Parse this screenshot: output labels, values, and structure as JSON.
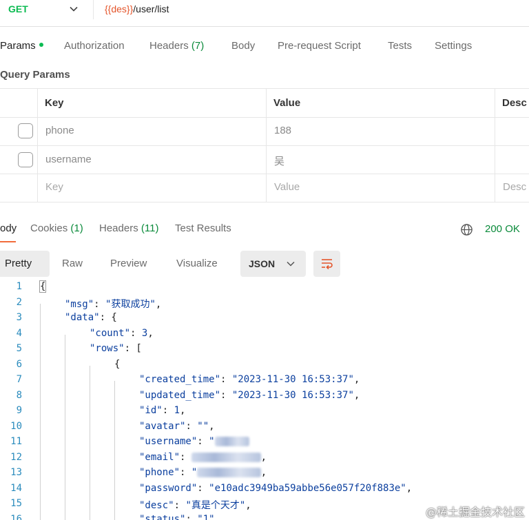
{
  "request": {
    "method": "GET",
    "url_var": "{{des}}",
    "url_path": "/user/list"
  },
  "req_tabs": [
    {
      "label": "Params",
      "count": "",
      "dot": true
    },
    {
      "label": "Authorization",
      "count": "",
      "dot": false
    },
    {
      "label": "Headers",
      "count": "(7)",
      "dot": false
    },
    {
      "label": "Body",
      "count": "",
      "dot": false
    },
    {
      "label": "Pre-request Script",
      "count": "",
      "dot": false
    },
    {
      "label": "Tests",
      "count": "",
      "dot": false
    },
    {
      "label": "Settings",
      "count": "",
      "dot": false
    }
  ],
  "query_params": {
    "title": "Query Params",
    "headers": {
      "key": "Key",
      "value": "Value",
      "desc": "Desc"
    },
    "rows": [
      {
        "key": "phone",
        "value": "188"
      },
      {
        "key": "username",
        "value": "吴"
      }
    ],
    "placeholders": {
      "key": "Key",
      "value": "Value",
      "desc": "Desc"
    }
  },
  "resp_tabs": [
    {
      "label": "ody",
      "count": ""
    },
    {
      "label": "Cookies",
      "count": "(1)"
    },
    {
      "label": "Headers",
      "count": "(11)"
    },
    {
      "label": "Test Results",
      "count": ""
    }
  ],
  "status": "200 OK",
  "views": [
    "Pretty",
    "Raw",
    "Preview",
    "Visualize"
  ],
  "format": "JSON",
  "code_lines": [
    {
      "n": "1",
      "parts": [
        [
          "pun",
          "{"
        ]
      ]
    },
    {
      "n": "2",
      "parts": [
        [
          "key",
          "\"msg\""
        ],
        [
          "pun",
          ": "
        ],
        [
          "str",
          "\"获取成功\""
        ],
        [
          "pun",
          ","
        ]
      ]
    },
    {
      "n": "3",
      "parts": [
        [
          "key",
          "\"data\""
        ],
        [
          "pun",
          ": {"
        ]
      ]
    },
    {
      "n": "4",
      "parts": [
        [
          "key",
          "\"count\""
        ],
        [
          "pun",
          ": "
        ],
        [
          "str",
          "3"
        ],
        [
          "pun",
          ","
        ]
      ]
    },
    {
      "n": "5",
      "parts": [
        [
          "key",
          "\"rows\""
        ],
        [
          "pun",
          ": ["
        ]
      ]
    },
    {
      "n": "6",
      "parts": [
        [
          "pun",
          "{"
        ]
      ]
    },
    {
      "n": "7",
      "parts": [
        [
          "key",
          "\"created_time\""
        ],
        [
          "pun",
          ": "
        ],
        [
          "str",
          "\"2023-11-30 16:53:37\""
        ],
        [
          "pun",
          ","
        ]
      ]
    },
    {
      "n": "8",
      "parts": [
        [
          "key",
          "\"updated_time\""
        ],
        [
          "pun",
          ": "
        ],
        [
          "str",
          "\"2023-11-30 16:53:37\""
        ],
        [
          "pun",
          ","
        ]
      ]
    },
    {
      "n": "9",
      "parts": [
        [
          "key",
          "\"id\""
        ],
        [
          "pun",
          ": "
        ],
        [
          "str",
          "1"
        ],
        [
          "pun",
          ","
        ]
      ]
    },
    {
      "n": "10",
      "parts": [
        [
          "key",
          "\"avatar\""
        ],
        [
          "pun",
          ": "
        ],
        [
          "str",
          "\"\""
        ],
        [
          "pun",
          ","
        ]
      ]
    },
    {
      "n": "11",
      "parts": [
        [
          "key",
          "\"username\""
        ],
        [
          "pun",
          ": "
        ],
        [
          "str",
          "\""
        ],
        [
          "blur",
          "6"
        ]
      ]
    },
    {
      "n": "12",
      "parts": [
        [
          "key",
          "\"email\""
        ],
        [
          "pun",
          ": "
        ],
        [
          "blur",
          "12"
        ],
        [
          "pun",
          ","
        ]
      ]
    },
    {
      "n": "13",
      "parts": [
        [
          "key",
          "\"phone\""
        ],
        [
          "pun",
          ": "
        ],
        [
          "str",
          "\""
        ],
        [
          "blur",
          "11"
        ],
        [
          "pun",
          ","
        ]
      ]
    },
    {
      "n": "14",
      "parts": [
        [
          "key",
          "\"password\""
        ],
        [
          "pun",
          ": "
        ],
        [
          "str",
          "\"e10adc3949ba59abbe56e057f20f883e\""
        ],
        [
          "pun",
          ","
        ]
      ]
    },
    {
      "n": "15",
      "parts": [
        [
          "key",
          "\"desc\""
        ],
        [
          "pun",
          ": "
        ],
        [
          "str",
          "\"真是个天才\""
        ],
        [
          "pun",
          ","
        ]
      ]
    },
    {
      "n": "16",
      "parts": [
        [
          "key",
          "\"status\""
        ],
        [
          "pun",
          ": "
        ],
        [
          "str",
          "\"1\""
        ]
      ]
    }
  ],
  "watermark": "@稀土掘金技术社区"
}
